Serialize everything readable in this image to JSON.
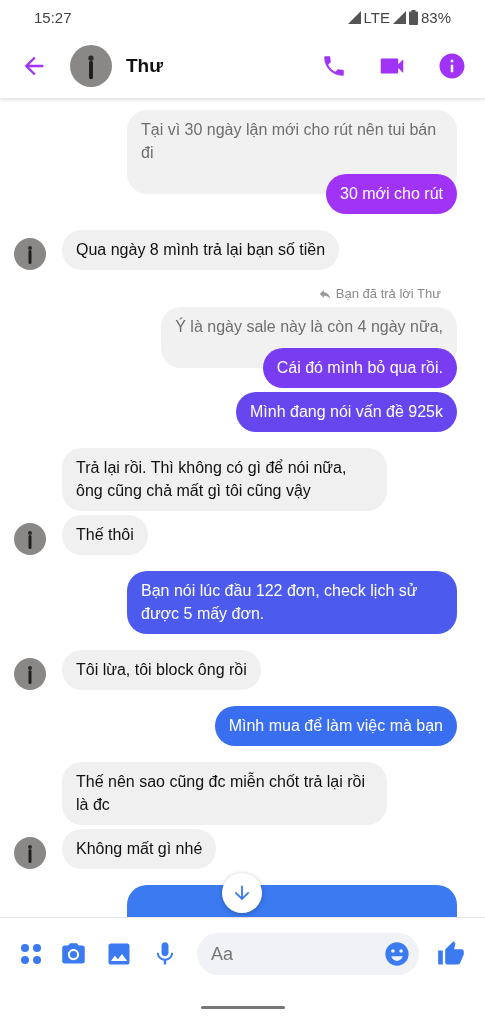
{
  "status_bar": {
    "time": "15:27",
    "network": "LTE",
    "battery": "83%"
  },
  "header": {
    "name": "Thư"
  },
  "thread": [
    {
      "kind": "outgoing",
      "quote": "Tại vì 30 ngày lận mới cho rút nên tui bán đi",
      "messages": [
        {
          "text": "30 mới cho rút",
          "color": "#a033f5"
        }
      ]
    },
    {
      "kind": "incoming",
      "messages": [
        {
          "text": "Qua ngày 8 mình trả lại bạn số tiền"
        }
      ]
    },
    {
      "kind": "reply_note",
      "text": "Bạn đã trả lời Thư"
    },
    {
      "kind": "outgoing",
      "quote": "Ý là ngày sale này là còn 4 ngày nữa,",
      "messages": [
        {
          "text": "Cái đó mình bỏ qua rồi.",
          "color": "#7a3cf1"
        },
        {
          "text": "Mình đang nói vấn đề 925k",
          "color": "#6546ef"
        }
      ]
    },
    {
      "kind": "incoming",
      "messages": [
        {
          "text": "Trả lại rồi. Thì không có gì để nói nữa, ông cũng chả mất gì tôi cũng vậy"
        },
        {
          "text": "Thế thôi"
        }
      ]
    },
    {
      "kind": "outgoing",
      "messages": [
        {
          "text": "Bạn nói lúc đầu 122 đơn, check lịch sử được 5 mấy đơn.",
          "color": "#4c5bee"
        }
      ]
    },
    {
      "kind": "incoming",
      "messages": [
        {
          "text": "Tôi lừa, tôi block ông rồi"
        }
      ]
    },
    {
      "kind": "outgoing",
      "messages": [
        {
          "text": "Mình mua để làm việc mà bạn",
          "color": "#3a6ef0"
        }
      ]
    },
    {
      "kind": "incoming",
      "messages": [
        {
          "text": "Thế nên sao cũng đc miễn chốt trả lại rồi là đc"
        },
        {
          "text": "Không mất gì nhé"
        }
      ]
    },
    {
      "kind": "outgoing_cut",
      "color": "#3b7af0"
    }
  ],
  "composer": {
    "placeholder": "Aa"
  }
}
